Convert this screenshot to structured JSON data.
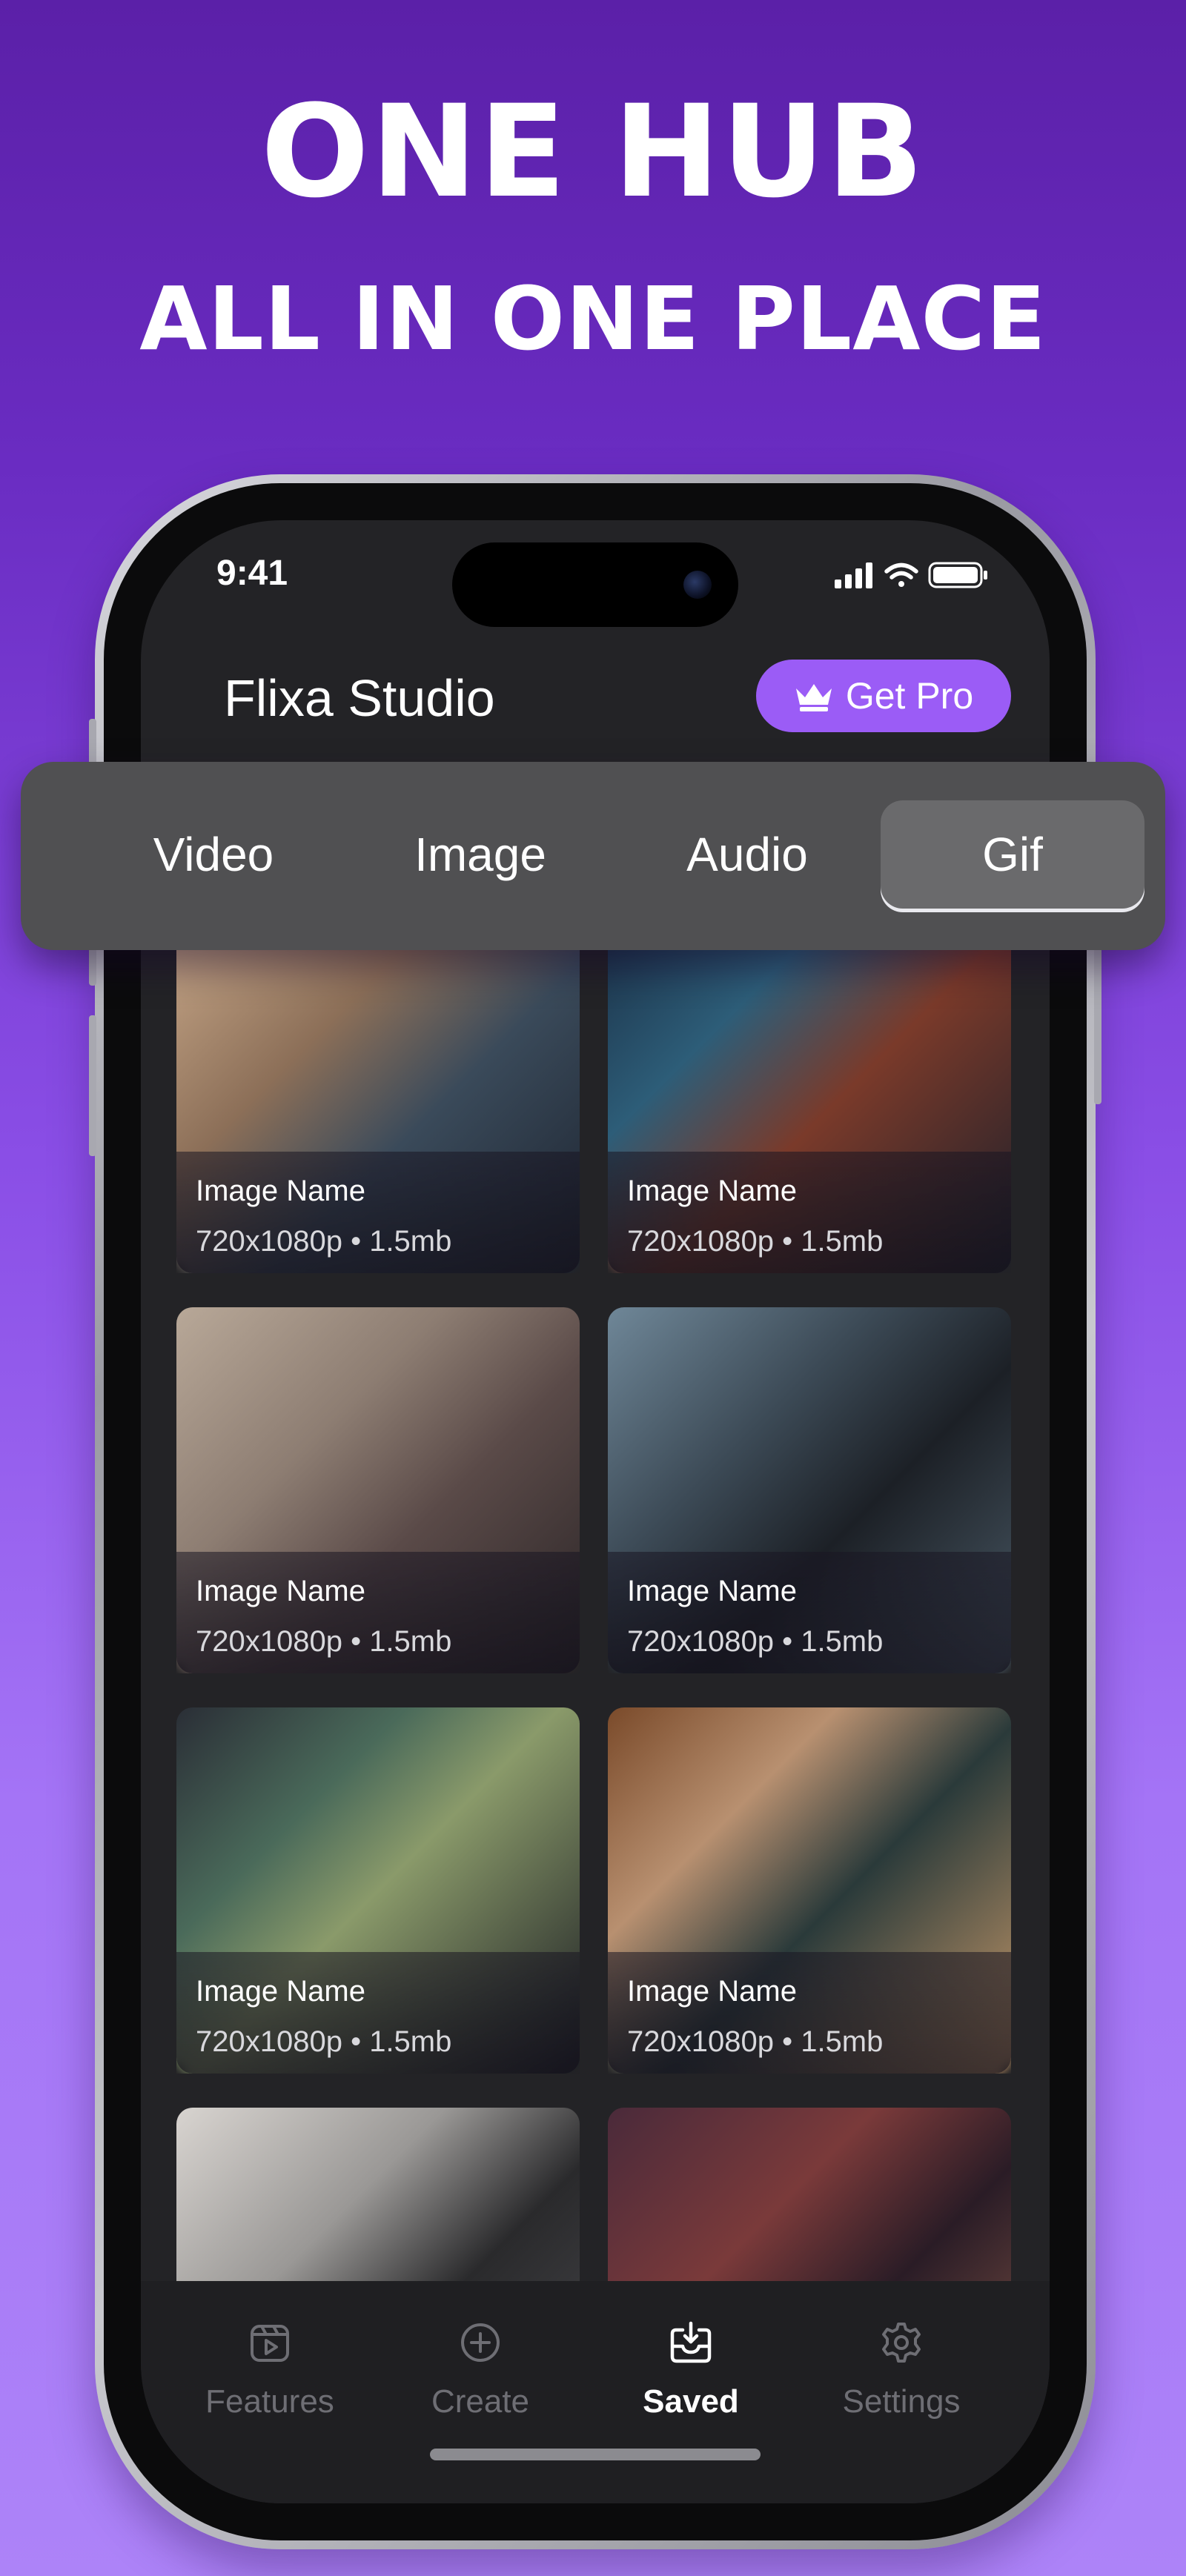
{
  "headline": {
    "line1": "ONE HUB",
    "line2": "ALL IN ONE PLACE"
  },
  "status_bar": {
    "time": "9:41",
    "icons": [
      "cellular-signal-icon",
      "wifi-icon",
      "battery-icon"
    ]
  },
  "header": {
    "app_title": "Flixa Studio",
    "pro_button_label": "Get Pro",
    "pro_icon": "crown-icon"
  },
  "media_tabs": {
    "items": [
      "Video",
      "Image",
      "Audio",
      "Gif"
    ],
    "selected": "Gif"
  },
  "media_cards": [
    {
      "name": "Image Name",
      "meta": "720x1080p • 1.5mb"
    },
    {
      "name": "Image Name",
      "meta": "720x1080p • 1.5mb"
    },
    {
      "name": "Image Name",
      "meta": "720x1080p • 1.5mb"
    },
    {
      "name": "Image Name",
      "meta": "720x1080p • 1.5mb"
    },
    {
      "name": "Image Name",
      "meta": "720x1080p • 1.5mb"
    },
    {
      "name": "Image Name",
      "meta": "720x1080p • 1.5mb"
    }
  ],
  "bottom_nav": {
    "items": [
      {
        "label": "Features",
        "icon": "video-frame-icon"
      },
      {
        "label": "Create",
        "icon": "plus-circle-icon"
      },
      {
        "label": "Saved",
        "icon": "download-tray-icon"
      },
      {
        "label": "Settings",
        "icon": "gear-icon"
      }
    ],
    "active": "Saved"
  },
  "colors": {
    "background_top": "#5b20a8",
    "background_bottom": "#ad83f8",
    "accent": "#9b5cf6",
    "screen_bg": "#232326",
    "segmented_bg": "#505052"
  }
}
